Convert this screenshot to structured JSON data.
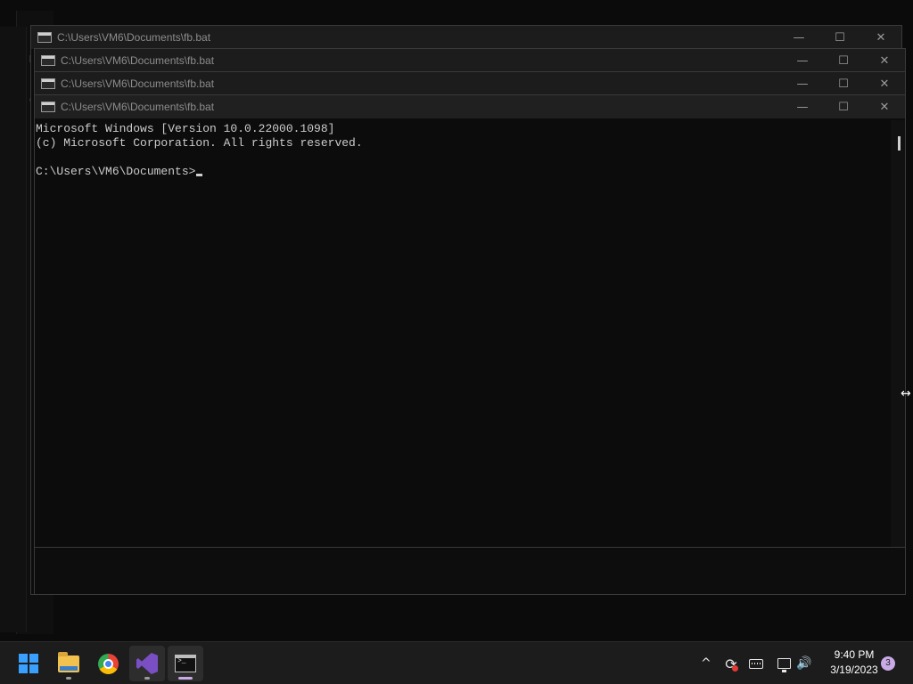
{
  "windows": [
    {
      "title": "C:\\Users\\VM6\\Documents\\fb.bat"
    },
    {
      "title": "C:\\Users\\VM6\\Documents\\fb.bat"
    },
    {
      "title": "C:\\Users\\VM6\\Documents\\fb.bat"
    },
    {
      "title": "C:\\Users\\VM6\\Documents\\fb.bat"
    }
  ],
  "caption": {
    "minimize": "—",
    "maximize": "☐",
    "close": "✕"
  },
  "console": {
    "line1": "Microsoft Windows [Version 10.0.22000.1098]",
    "line2": "(c) Microsoft Corporation. All rights reserved.",
    "prompt": "C:\\Users\\VM6\\Documents>"
  },
  "background_chars": [
    "M",
    "(",
    "C"
  ],
  "resize_cursor": "↔",
  "taskbar": {
    "apps": [
      {
        "name": "start",
        "icon": "windows-logo-icon"
      },
      {
        "name": "file-explorer",
        "icon": "folder-icon"
      },
      {
        "name": "chrome",
        "icon": "chrome-icon"
      },
      {
        "name": "visual-studio",
        "icon": "visual-studio-icon"
      },
      {
        "name": "command-prompt",
        "icon": "terminal-icon"
      }
    ],
    "tray": {
      "chevron": "^",
      "sync": "⟳",
      "volume": "🔊"
    },
    "clock": {
      "time": "9:40 PM",
      "date": "3/19/2023"
    },
    "notifications": "3"
  },
  "colors": {
    "accent_start": "#3aa0ff",
    "cmd_text": "#cccccc",
    "taskbar": "#1c1c1c"
  }
}
